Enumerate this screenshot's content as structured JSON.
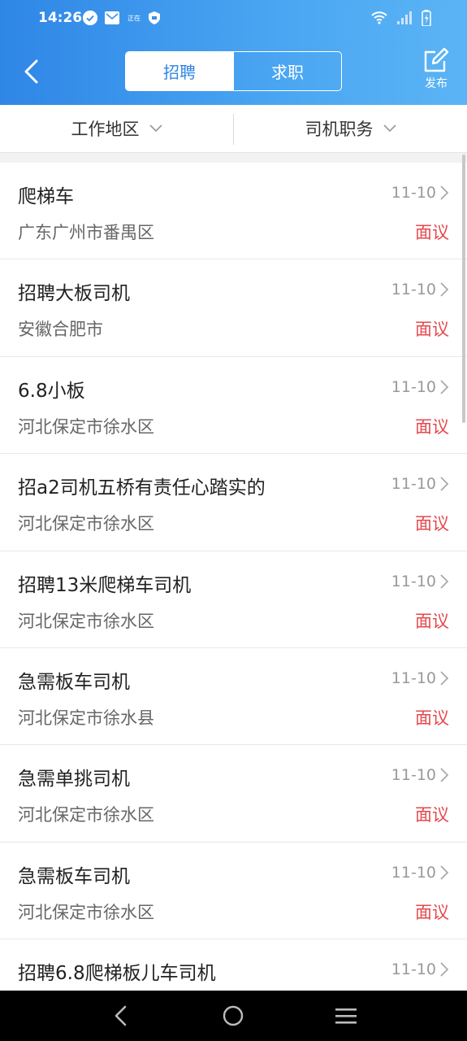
{
  "status_bar": {
    "time": "14:26",
    "tiny_badge": "正在"
  },
  "header": {
    "tabs": [
      {
        "label": "招聘",
        "active": true
      },
      {
        "label": "求职",
        "active": false
      }
    ],
    "publish_label": "发布"
  },
  "filters": [
    {
      "label": "工作地区"
    },
    {
      "label": "司机职务"
    }
  ],
  "jobs": [
    {
      "title": "爬梯车",
      "date": "11-10",
      "location": "广东广州市番禺区",
      "salary": "面议"
    },
    {
      "title": "招聘大板司机",
      "date": "11-10",
      "location": "安徽合肥市",
      "salary": "面议"
    },
    {
      "title": "6.8小板",
      "date": "11-10",
      "location": "河北保定市徐水区",
      "salary": "面议"
    },
    {
      "title": "招a2司机五桥有责任心踏实的",
      "date": "11-10",
      "location": "河北保定市徐水区",
      "salary": "面议"
    },
    {
      "title": "招聘13米爬梯车司机",
      "date": "11-10",
      "location": "河北保定市徐水区",
      "salary": "面议"
    },
    {
      "title": "急需板车司机",
      "date": "11-10",
      "location": "河北保定市徐水县",
      "salary": "面议"
    },
    {
      "title": "急需单挑司机",
      "date": "11-10",
      "location": "河北保定市徐水区",
      "salary": "面议"
    },
    {
      "title": "急需板车司机",
      "date": "11-10",
      "location": "河北保定市徐水区",
      "salary": "面议"
    },
    {
      "title": "招聘6.8爬梯板儿车司机",
      "date": "11-10",
      "location": "",
      "salary": ""
    }
  ],
  "colors": {
    "header_start": "#2f86e6",
    "header_end": "#5bb4f5",
    "salary": "#e5484d",
    "active_tab_text": "#2f86e6"
  }
}
